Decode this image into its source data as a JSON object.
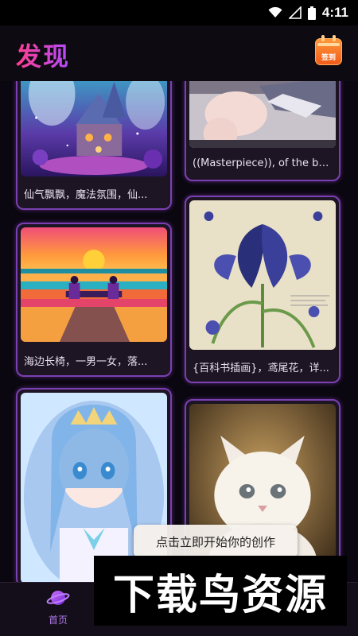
{
  "status_bar": {
    "time": "4:11",
    "icons": [
      "wifi-icon",
      "signal-icon",
      "battery-icon"
    ]
  },
  "header": {
    "title": "发现",
    "checkin_label": "签到"
  },
  "feed": {
    "cards": [
      {
        "caption": "仙气飘飘，魔法氛围，仙...",
        "image": "fairy-house"
      },
      {
        "caption": "((Masterpiece)), of the bes...",
        "image": "anime-legs"
      },
      {
        "caption": "海边长椅，一男一女，落...",
        "image": "sunset-bench"
      },
      {
        "caption": "{百科书插画}，鸢尾花，详...",
        "image": "iris-botanical"
      },
      {
        "caption": "",
        "image": "anime-princess"
      },
      {
        "caption": "",
        "image": "white-kitten"
      }
    ]
  },
  "toast": {
    "text": "点击立即开始你的创作"
  },
  "bottom_nav": {
    "items": [
      {
        "label": "首页",
        "icon": "planet-icon",
        "active": true
      }
    ]
  },
  "watermark": {
    "text": "下载鸟资源"
  },
  "colors": {
    "accent": "#b14bff",
    "title_gradient_start": "#ff3f8f",
    "card_border": "#7a3fb0",
    "background": "#0b0710"
  }
}
